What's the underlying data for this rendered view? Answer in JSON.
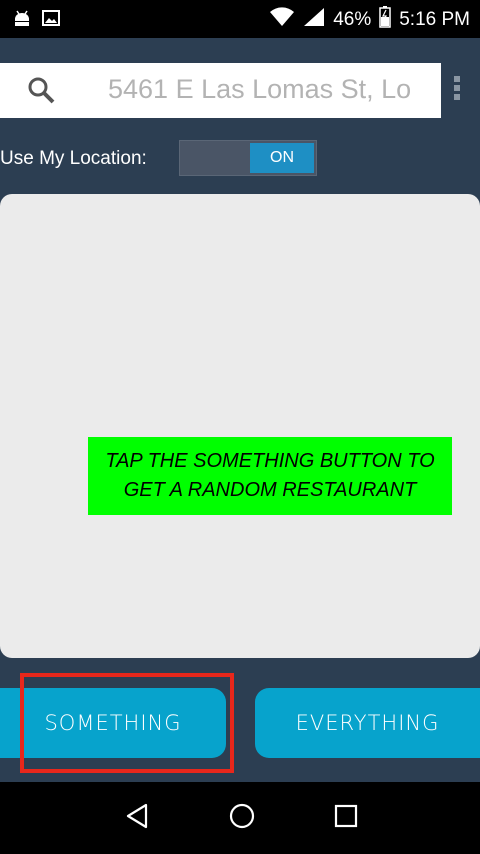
{
  "status_bar": {
    "battery": "46%",
    "time": "5:16 PM",
    "icons": [
      "android-debug-icon",
      "gallery-icon",
      "wifi-icon",
      "signal-icon",
      "battery-icon"
    ]
  },
  "search": {
    "value": "5461 E Las Lomas St, Lo"
  },
  "location": {
    "label": "Use My Location:",
    "toggle_state": "ON"
  },
  "result": {
    "hint": "TAP THE SOMETHING BUTTON TO GET A RANDOM RESTAURANT"
  },
  "buttons": {
    "something": "SOMETHING",
    "everything": "EVERYTHING"
  },
  "colors": {
    "background": "#2c3e52",
    "accent": "#07a3cc",
    "hint_bg": "#00ff00",
    "highlight": "#e8271b",
    "toggle_on": "#1e8fc4"
  }
}
